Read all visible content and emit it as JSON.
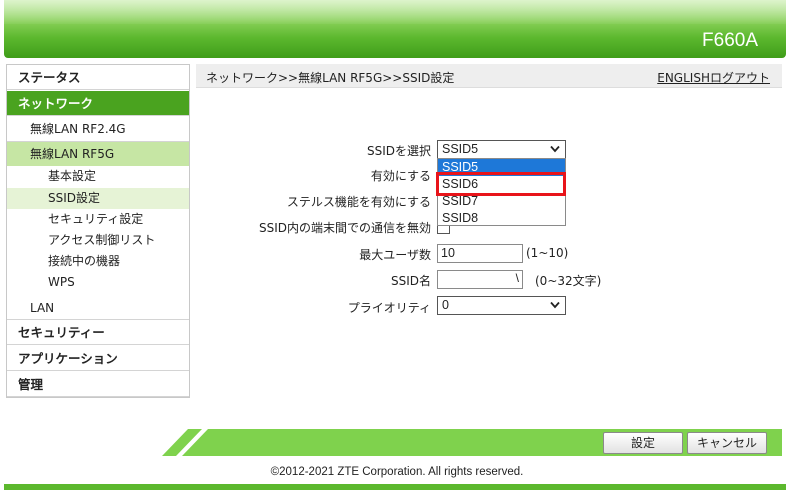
{
  "header": {
    "model": "F660A"
  },
  "sidebar": {
    "status": "ステータス",
    "network": "ネットワーク",
    "wlan24": "無線LAN RF2.4G",
    "wlan5": "無線LAN RF5G",
    "basic": "基本設定",
    "ssid": "SSID設定",
    "security_setting": "セキュリティ設定",
    "acl": "アクセス制御リスト",
    "devices": "接続中の機器",
    "wps": "WPS",
    "lan": "LAN",
    "security": "セキュリティー",
    "application": "アプリケーション",
    "admin": "管理"
  },
  "breadcrumb": "ネットワーク>>無線LAN RF5G>>SSID設定",
  "links": {
    "english": "ENGLISH",
    "logout": "ログアウト"
  },
  "form": {
    "ssid_select_label": "SSIDを選択",
    "ssid_select_value": "SSID5",
    "enable_label": "有効にする",
    "stealth_label": "ステルス機能を有効にする",
    "isolation_label": "SSID内の端末間での通信を無効",
    "max_users_label": "最大ユーザ数",
    "max_users_value": "10",
    "max_users_hint": "(1~10)",
    "ssid_name_label": "SSID名",
    "ssid_name_hint": "(0~32文字)",
    "priority_label": "プライオリティ",
    "priority_value": "0"
  },
  "dropdown": {
    "options": [
      "SSID5",
      "SSID6",
      "SSID7",
      "SSID8"
    ]
  },
  "buttons": {
    "apply": "設定",
    "cancel": "キャンセル"
  },
  "footer": {
    "copyright": "©2012-2021 ZTE Corporation. All rights reserved."
  },
  "colors": {
    "accent": "#4aa31f",
    "highlight": "#1e78d8",
    "marker": "#e8141a"
  }
}
